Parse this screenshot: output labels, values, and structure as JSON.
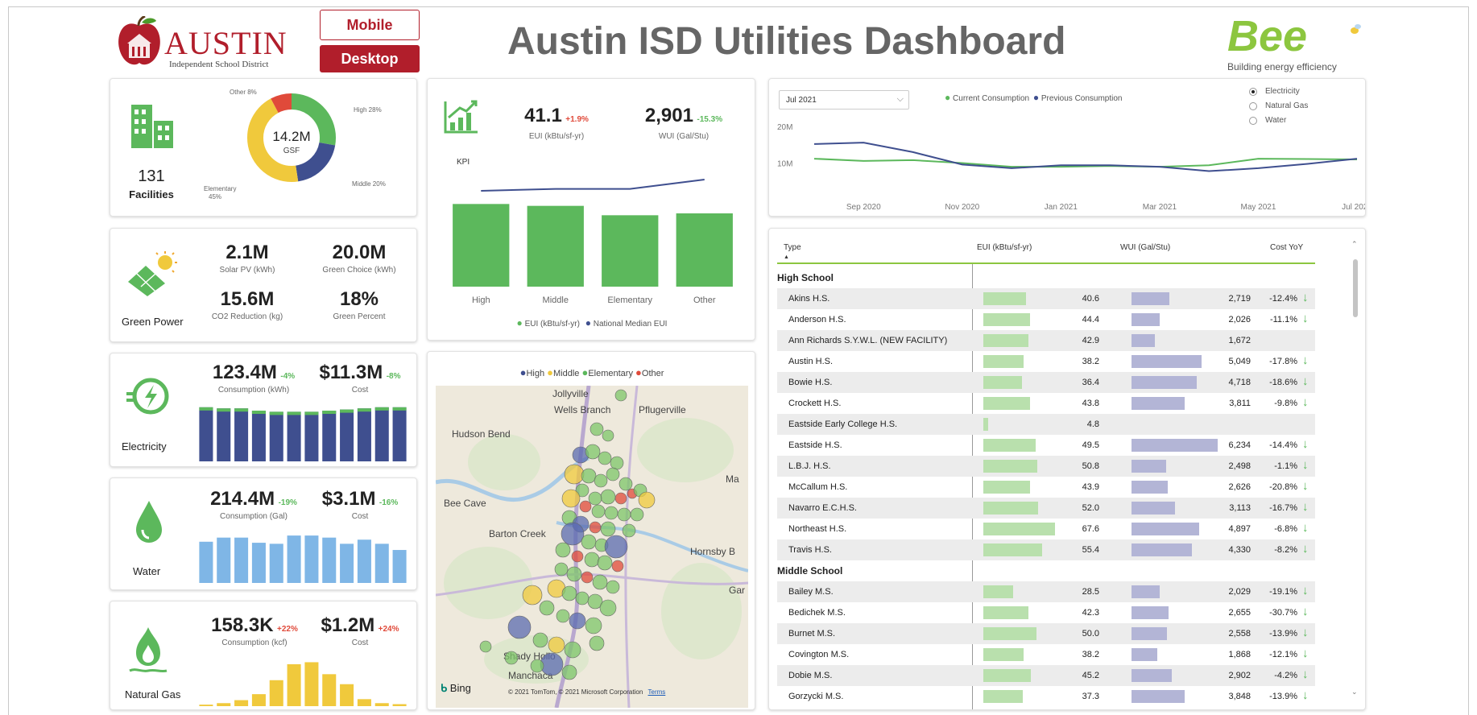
{
  "header": {
    "title": "Austin ISD Utilities Dashboard",
    "logo_austin": "AUSTIN",
    "logo_sub": "Independent School District",
    "mobile_label": "Mobile",
    "desktop_label": "Desktop",
    "bee_logo": "Bee",
    "bee_tagline": "Building energy efficiency"
  },
  "facilities": {
    "count": "131",
    "label": "Facilities",
    "gsf_value": "14.2M",
    "gsf_label": "GSF",
    "slice_other": "Other 8%",
    "slice_high": "High 28%",
    "slice_middle": "Middle 20%",
    "slice_elem_1": "Elementary",
    "slice_elem_2": "45%",
    "donut": [
      {
        "name": "High",
        "value": 28,
        "color": "#5cb85c"
      },
      {
        "name": "Middle",
        "value": 20,
        "color": "#3f4f8f"
      },
      {
        "name": "Elementary",
        "value": 45,
        "color": "#f0c93c"
      },
      {
        "name": "Other",
        "value": 8,
        "color": "#e04a3a"
      }
    ]
  },
  "green_power": {
    "label": "Green Power",
    "solar_value": "2.1M",
    "solar_label": "Solar PV (kWh)",
    "choice_value": "20.0M",
    "choice_label": "Green Choice (kWh)",
    "co2_value": "15.6M",
    "co2_label": "CO2 Reduction (kg)",
    "pct_value": "18%",
    "pct_label": "Green Percent"
  },
  "electricity": {
    "label": "Electricity",
    "consumption": "123.4M",
    "consumption_change": "-4%",
    "consumption_label": "Consumption (kWh)",
    "cost": "$11.3M",
    "cost_change": "-8%",
    "cost_label": "Cost",
    "bars": [
      9.6,
      9.4,
      9.4,
      9.0,
      8.8,
      8.8,
      8.8,
      9.0,
      9.2,
      9.4,
      9.6,
      9.6
    ]
  },
  "water": {
    "label": "Water",
    "consumption": "214.4M",
    "consumption_change": "-19%",
    "consumption_label": "Consumption (Gal)",
    "cost": "$3.1M",
    "cost_change": "-16%",
    "cost_label": "Cost",
    "bars": [
      8.0,
      8.8,
      8.8,
      7.8,
      7.6,
      9.2,
      9.2,
      8.8,
      7.6,
      8.4,
      7.6,
      6.4
    ]
  },
  "gas": {
    "label": "Natural Gas",
    "consumption": "158.3K",
    "consumption_change": "+22%",
    "consumption_label": "Consumption (kcf)",
    "cost": "$1.2M",
    "cost_change": "+24%",
    "cost_label": "Cost",
    "bars": [
      0.3,
      0.6,
      1.2,
      2.4,
      5.2,
      8.4,
      8.8,
      6.4,
      4.4,
      1.4,
      0.6,
      0.4
    ]
  },
  "kpi": {
    "label": "KPI",
    "eui_value": "41.1",
    "eui_change": "+1.9%",
    "eui_label": "EUI (kBtu/sf-yr)",
    "wui_value": "2,901",
    "wui_change": "-15.3%",
    "wui_label": "WUI (Gal/Stu)",
    "legend_eui": "EUI (kBtu/sf-yr)",
    "legend_median": "National Median EUI",
    "chart_data": {
      "type": "bar",
      "categories": [
        "High",
        "Middle",
        "Elementary",
        "Other"
      ],
      "series": [
        {
          "name": "EUI (kBtu/sf-yr)",
          "values": [
            44,
            43,
            38,
            39
          ]
        },
        {
          "name": "National Median EUI",
          "values": [
            51,
            52,
            52,
            57
          ]
        }
      ],
      "ylim": [
        0,
        60
      ]
    }
  },
  "map": {
    "legend": [
      {
        "label": "High",
        "color": "#3f4f8f"
      },
      {
        "label": "Middle",
        "color": "#f0c93c"
      },
      {
        "label": "Elementary",
        "color": "#5cb85c"
      },
      {
        "label": "Other",
        "color": "#e04a3a"
      }
    ],
    "places": [
      "Jollyville",
      "Wells Branch",
      "Pflugerville",
      "Hudson Bend",
      "Bee Cave",
      "Barton Creek",
      "Hornsby B",
      "Shady Hollo",
      "Manchaca",
      "Ma",
      "Gar"
    ],
    "bing": "Bing",
    "copyright": "© 2021 TomTom, © 2021 Microsoft Corporation",
    "terms": "Terms"
  },
  "trend": {
    "month_select": "Jul 2021",
    "legend_current": "Current Consumption",
    "legend_previous": "Previous Consumption",
    "options": [
      "Electricity",
      "Natural Gas",
      "Water"
    ],
    "selected_option": "Electricity",
    "chart_data": {
      "type": "line",
      "x": [
        "Aug 2020",
        "Sep 2020",
        "Oct 2020",
        "Nov 2020",
        "Dec 2020",
        "Jan 2021",
        "Feb 2021",
        "Mar 2021",
        "Apr 2021",
        "May 2021",
        "Jun 2021",
        "Jul 2021"
      ],
      "x_ticks": [
        "Sep 2020",
        "Nov 2020",
        "Jan 2021",
        "Mar 2021",
        "May 2021",
        "Jul 2021"
      ],
      "y_ticks": [
        "20M",
        "10M"
      ],
      "series": [
        {
          "name": "Current Consumption",
          "color": "#5cb85c",
          "values": [
            11.2,
            10.6,
            10.8,
            10.0,
            9.0,
            9.0,
            9.2,
            9.0,
            9.4,
            11.2,
            11.1,
            11.0
          ]
        },
        {
          "name": "Previous Consumption",
          "color": "#3f4f8f",
          "values": [
            15.2,
            15.6,
            13.0,
            9.6,
            8.6,
            9.4,
            9.4,
            9.0,
            7.8,
            8.6,
            9.8,
            11.2
          ]
        }
      ],
      "ylim": [
        0,
        22
      ]
    }
  },
  "table": {
    "headers": {
      "type": "Type",
      "eui": "EUI (kBtu/sf-yr)",
      "wui": "WUI (Gal/Stu)",
      "cost": "Cost YoY"
    },
    "groups": [
      {
        "name": "High School",
        "rows": [
          {
            "name": "Akins H.S.",
            "eui": "40.6",
            "wui": "2,719",
            "cost": "-12.4%",
            "eui_n": 40.6,
            "wui_n": 2719
          },
          {
            "name": "Anderson H.S.",
            "eui": "44.4",
            "wui": "2,026",
            "cost": "-11.1%",
            "eui_n": 44.4,
            "wui_n": 2026
          },
          {
            "name": "Ann Richards S.Y.W.L. (NEW FACILITY)",
            "eui": "42.9",
            "wui": "1,672",
            "cost": "",
            "eui_n": 42.9,
            "wui_n": 1672
          },
          {
            "name": "Austin H.S.",
            "eui": "38.2",
            "wui": "5,049",
            "cost": "-17.8%",
            "eui_n": 38.2,
            "wui_n": 5049
          },
          {
            "name": "Bowie H.S.",
            "eui": "36.4",
            "wui": "4,718",
            "cost": "-18.6%",
            "eui_n": 36.4,
            "wui_n": 4718
          },
          {
            "name": "Crockett H.S.",
            "eui": "43.8",
            "wui": "3,811",
            "cost": "-9.8%",
            "eui_n": 43.8,
            "wui_n": 3811
          },
          {
            "name": "Eastside Early College H.S.",
            "eui": "4.8",
            "wui": "",
            "cost": "",
            "eui_n": 4.8,
            "wui_n": 0
          },
          {
            "name": "Eastside H.S.",
            "eui": "49.5",
            "wui": "6,234",
            "cost": "-14.4%",
            "eui_n": 49.5,
            "wui_n": 6234
          },
          {
            "name": "L.B.J. H.S.",
            "eui": "50.8",
            "wui": "2,498",
            "cost": "-1.1%",
            "eui_n": 50.8,
            "wui_n": 2498
          },
          {
            "name": "McCallum H.S.",
            "eui": "43.9",
            "wui": "2,626",
            "cost": "-20.8%",
            "eui_n": 43.9,
            "wui_n": 2626
          },
          {
            "name": "Navarro E.C.H.S.",
            "eui": "52.0",
            "wui": "3,113",
            "cost": "-16.7%",
            "eui_n": 52.0,
            "wui_n": 3113
          },
          {
            "name": "Northeast H.S.",
            "eui": "67.6",
            "wui": "4,897",
            "cost": "-6.8%",
            "eui_n": 67.6,
            "wui_n": 4897
          },
          {
            "name": "Travis H.S.",
            "eui": "55.4",
            "wui": "4,330",
            "cost": "-8.2%",
            "eui_n": 55.4,
            "wui_n": 4330
          }
        ]
      },
      {
        "name": "Middle School",
        "rows": [
          {
            "name": "Bailey M.S.",
            "eui": "28.5",
            "wui": "2,029",
            "cost": "-19.1%",
            "eui_n": 28.5,
            "wui_n": 2029
          },
          {
            "name": "Bedichek M.S.",
            "eui": "42.3",
            "wui": "2,655",
            "cost": "-30.7%",
            "eui_n": 42.3,
            "wui_n": 2655
          },
          {
            "name": "Burnet M.S.",
            "eui": "50.0",
            "wui": "2,558",
            "cost": "-13.9%",
            "eui_n": 50.0,
            "wui_n": 2558
          },
          {
            "name": "Covington M.S.",
            "eui": "38.2",
            "wui": "1,868",
            "cost": "-12.1%",
            "eui_n": 38.2,
            "wui_n": 1868
          },
          {
            "name": "Dobie M.S.",
            "eui": "45.2",
            "wui": "2,902",
            "cost": "-4.2%",
            "eui_n": 45.2,
            "wui_n": 2902
          },
          {
            "name": "Gorzycki M.S.",
            "eui": "37.3",
            "wui": "3,848",
            "cost": "-13.9%",
            "eui_n": 37.3,
            "wui_n": 3848
          }
        ]
      }
    ]
  }
}
